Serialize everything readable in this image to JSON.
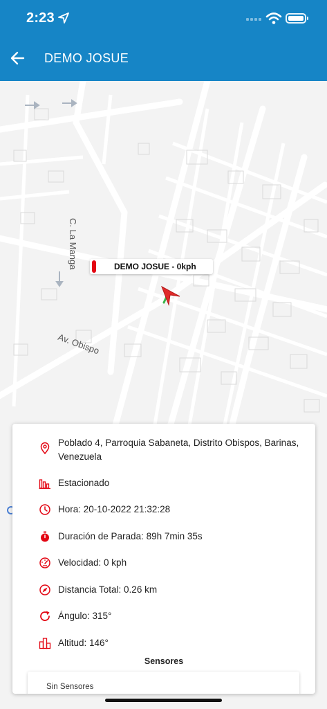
{
  "status_bar": {
    "time": "2:23"
  },
  "header": {
    "title": "DEMO JOSUE"
  },
  "map": {
    "streets": {
      "la_manga": "C. La Manga",
      "obispo": "Av. Obispo"
    },
    "marker_label": "DEMO JOSUE - 0kph"
  },
  "info": {
    "address": [
      "Poblado 4, Parroquia Sabaneta, Distrito Obispos, Barinas,",
      "Venezuela"
    ],
    "status": "Estacionado",
    "time": "Hora: 20-10-2022 21:32:28",
    "stop_duration": "Duración de Parada: 89h 7min 35s",
    "speed": "Velocidad: 0 kph",
    "distance": "Distancia Total: 0.26 km",
    "angle": "Ángulo: 315°",
    "altitude": "Altitud: 146°",
    "sensors_title": "Sensores",
    "sensors_empty": "Sin Sensores"
  },
  "colors": {
    "header": "#1685c6",
    "accent": "#e30613",
    "map_bg": "#f3f3f3"
  },
  "icons": [
    "location-arrow-icon",
    "wifi-icon",
    "battery-icon",
    "back-arrow-icon",
    "map-pin-icon",
    "bar-chart-icon",
    "clock-icon",
    "stopwatch-icon",
    "speedometer-icon",
    "compass-icon",
    "rotate-icon",
    "buildings-icon"
  ]
}
